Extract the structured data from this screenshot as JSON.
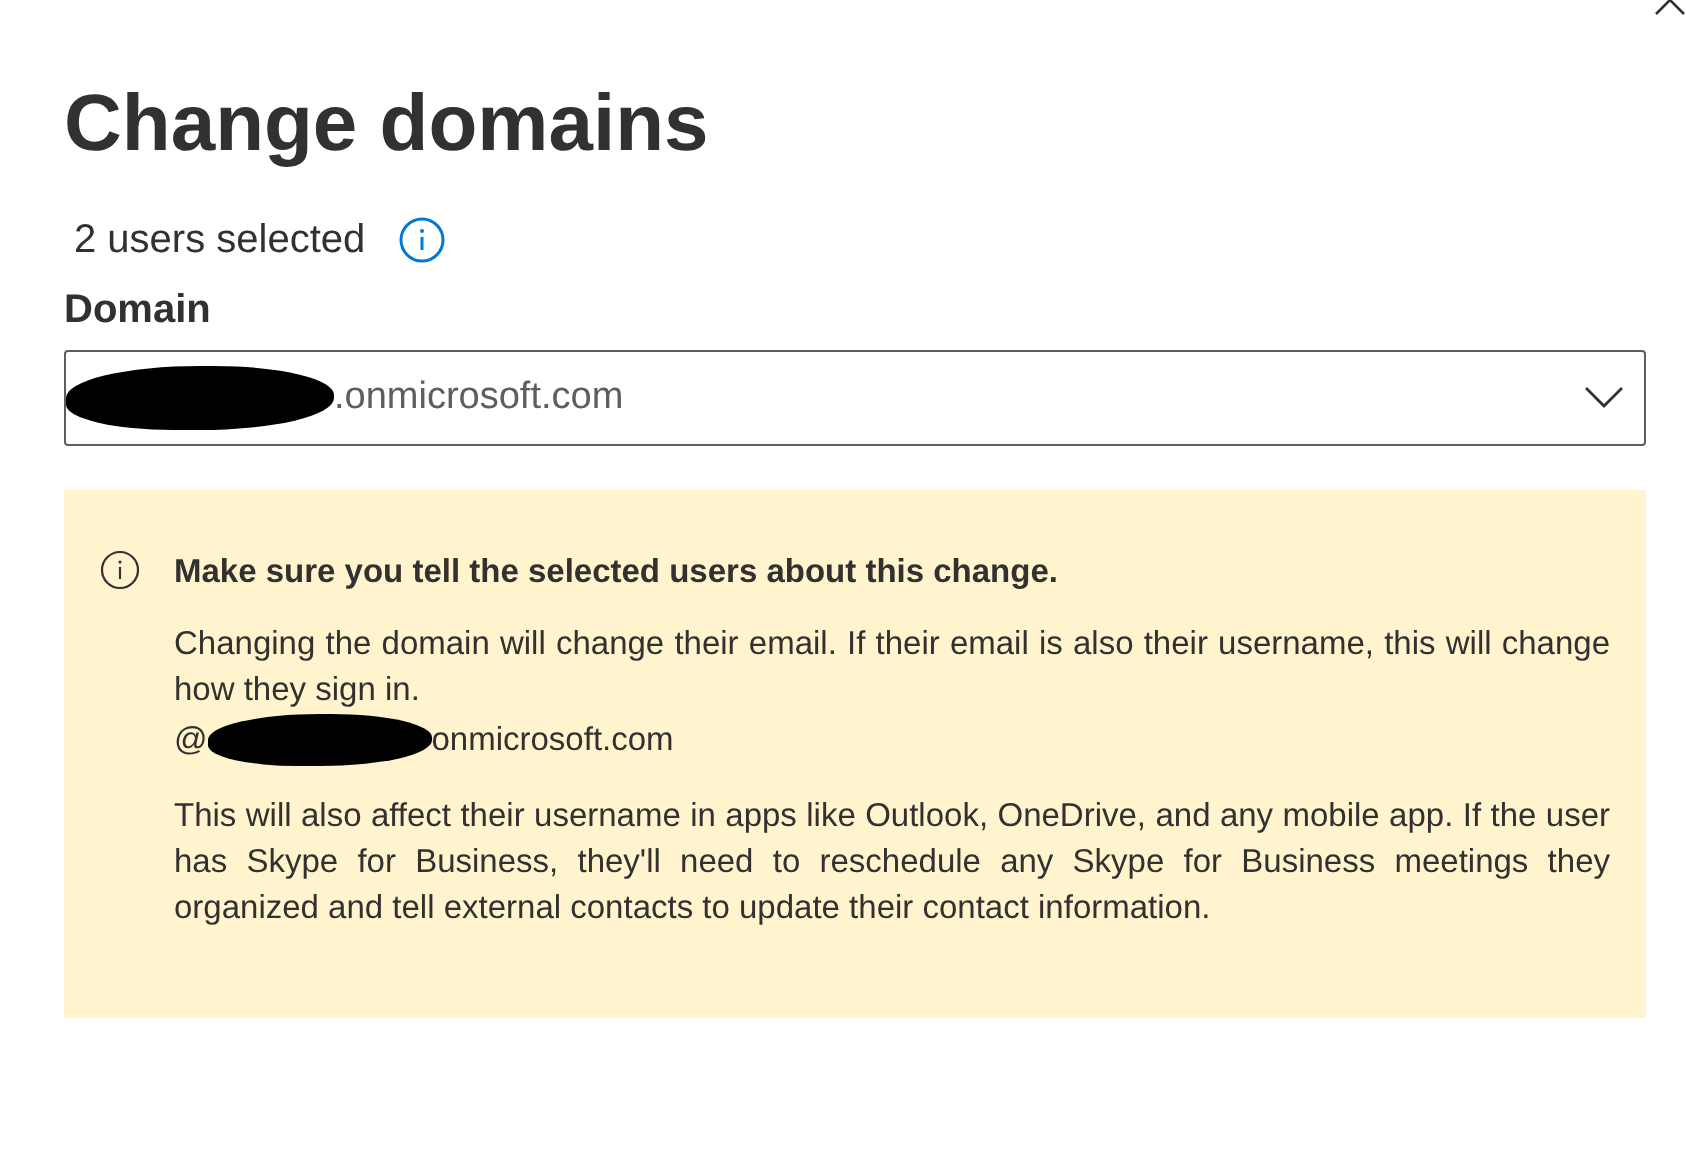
{
  "panel": {
    "title": "Change domains",
    "selection_count": "2 users selected"
  },
  "domain_field": {
    "label": "Domain",
    "value": ".onmicrosoft.com",
    "redacted": true
  },
  "warning": {
    "heading": "Make sure you tell the selected users about this change.",
    "paragraph_1": "Changing the domain will change their email. If their email is also their username, this will change how they sign in.",
    "address_prefix": "@",
    "address_suffix": "onmicrosoft.com",
    "paragraph_2": "This will also affect their username in apps like Outlook, OneDrive, and any mobile app. If the user has Skype for Business, they'll need to reschedule any Skype for Business meetings they organized and tell external contacts to update their contact information."
  }
}
